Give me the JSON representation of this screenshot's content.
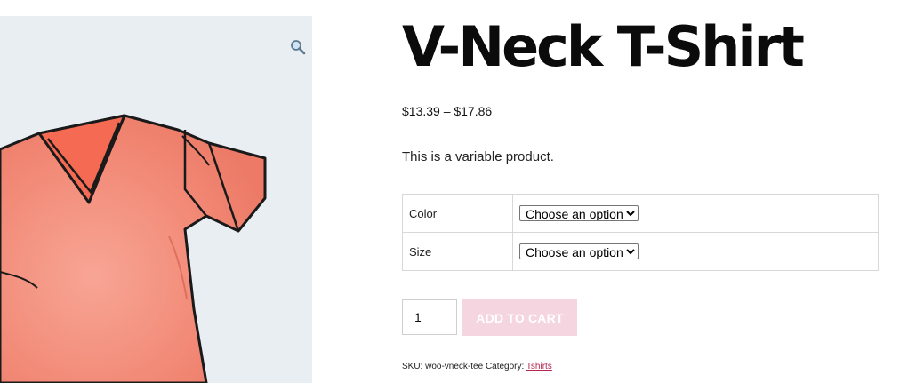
{
  "gallery": {
    "zoom_icon": "magnifier-icon",
    "image_icon": "tshirt-illustration",
    "background_color": "#e9eef2",
    "shirt_color": "#f28b78"
  },
  "product": {
    "title": "V-Neck T-Shirt",
    "price": "$13.39 – $17.86",
    "description": "This is a variable product."
  },
  "variations": [
    {
      "label": "Color",
      "selected": "Choose an option"
    },
    {
      "label": "Size",
      "selected": "Choose an option"
    }
  ],
  "cart": {
    "quantity": "1",
    "button_label": "ADD TO CART",
    "button_color": "#f5d5df"
  },
  "meta": {
    "sku_label": "SKU:",
    "sku_value": "woo-vneck-tee",
    "category_label": "Category:",
    "category_value": "Tshirts",
    "link_color": "#b3244e"
  }
}
